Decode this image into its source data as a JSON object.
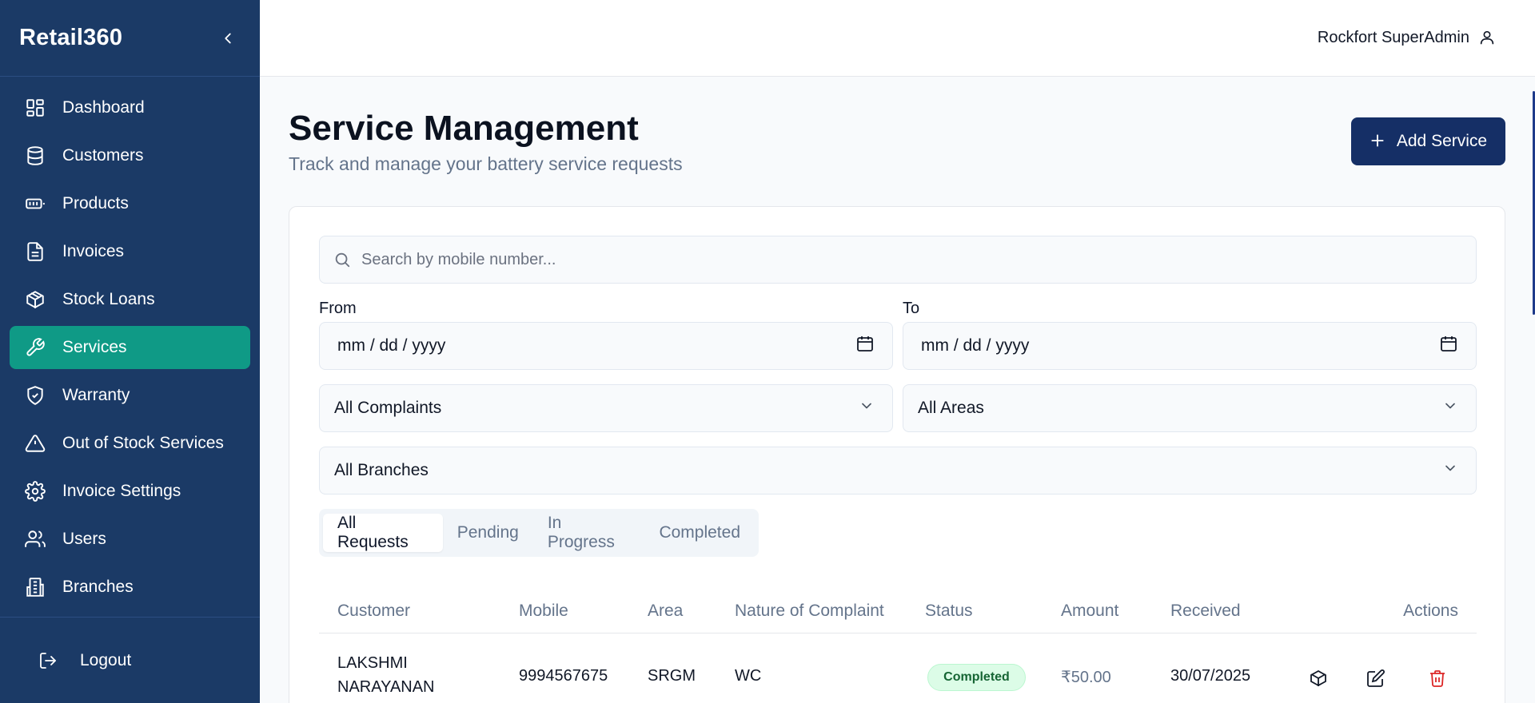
{
  "sidebar": {
    "brand": "Retail360",
    "items": [
      {
        "label": "Dashboard",
        "icon": "dashboard-icon"
      },
      {
        "label": "Customers",
        "icon": "database-icon"
      },
      {
        "label": "Products",
        "icon": "battery-icon"
      },
      {
        "label": "Invoices",
        "icon": "document-icon"
      },
      {
        "label": "Stock Loans",
        "icon": "package-icon"
      },
      {
        "label": "Services",
        "icon": "wrench-icon"
      },
      {
        "label": "Warranty",
        "icon": "shield-check-icon"
      },
      {
        "label": "Out of Stock Services",
        "icon": "alert-triangle-icon"
      },
      {
        "label": "Invoice Settings",
        "icon": "gear-icon"
      },
      {
        "label": "Users",
        "icon": "users-icon"
      },
      {
        "label": "Branches",
        "icon": "building-icon"
      }
    ],
    "active_item": "Services",
    "logout_label": "Logout"
  },
  "topbar": {
    "user_name": "Rockfort SuperAdmin"
  },
  "page": {
    "title": "Service Management",
    "subtitle": "Track and manage your battery service requests",
    "add_button_label": "Add Service"
  },
  "filters": {
    "search_placeholder": "Search by mobile number...",
    "from_label": "From",
    "to_label": "To",
    "from_value": "mm / dd / yyyy",
    "to_value": "mm / dd / yyyy",
    "complaints_selected": "All Complaints",
    "areas_selected": "All Areas",
    "branches_selected": "All Branches"
  },
  "tabs": [
    {
      "label": "All Requests",
      "active": true
    },
    {
      "label": "Pending",
      "active": false
    },
    {
      "label": "In Progress",
      "active": false
    },
    {
      "label": "Completed",
      "active": false
    }
  ],
  "table": {
    "headers": [
      "Customer",
      "Mobile",
      "Area",
      "Nature of Complaint",
      "Status",
      "Amount",
      "Received",
      "Actions"
    ],
    "rows": [
      {
        "customer_line1": "LAKSHMI",
        "customer_line2": "NARAYANAN",
        "mobile": "9994567675",
        "area": "SRGM",
        "complaint": "WC",
        "status": "Completed",
        "amount": "₹50.00",
        "received": "30/07/2025"
      }
    ]
  },
  "colors": {
    "sidebar_bg": "#1b3a66",
    "active_nav": "#0f9a86",
    "primary_button": "#152f66",
    "status_completed_bg": "#dcfce7",
    "status_completed_text": "#166534",
    "delete_red": "#dc2626"
  }
}
